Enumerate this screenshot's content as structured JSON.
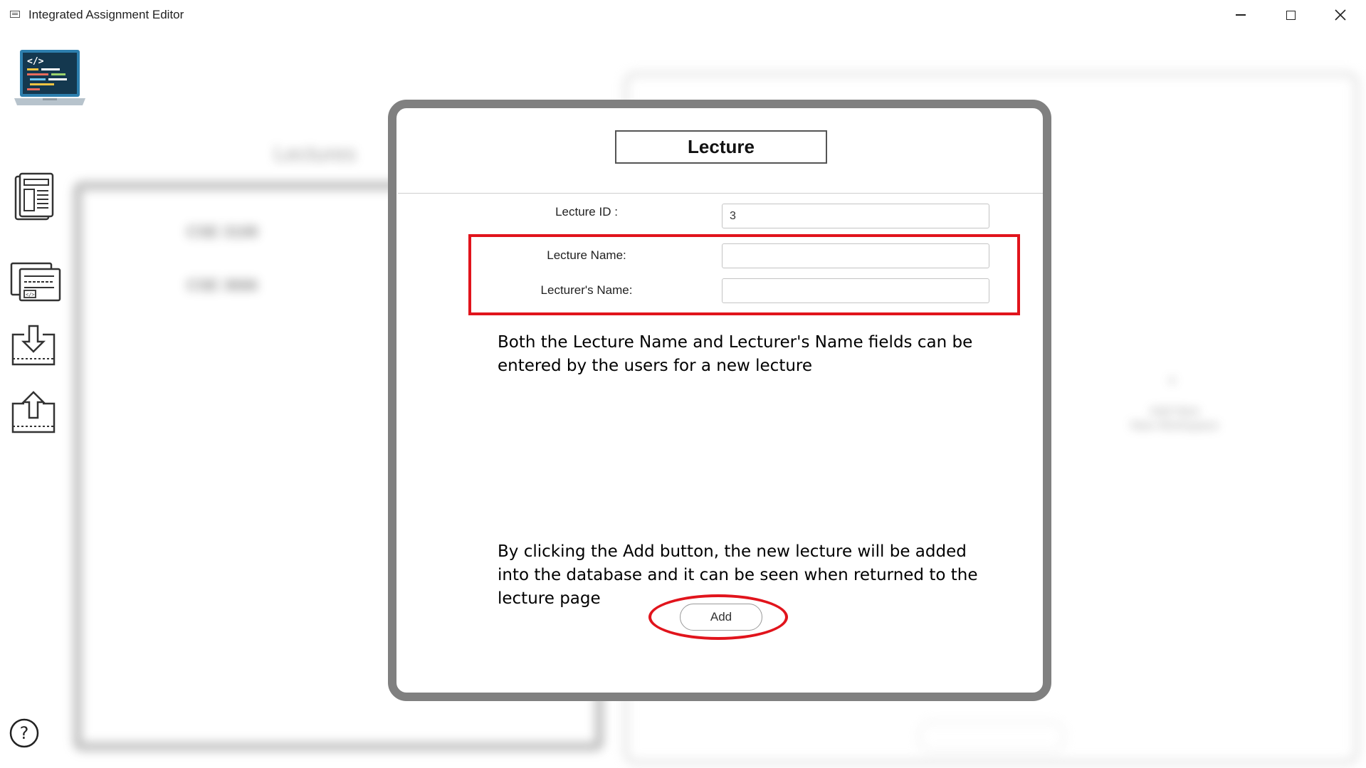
{
  "window": {
    "title": "Integrated Assignment Editor"
  },
  "background": {
    "list_title": "Lectures",
    "rows": [
      "CSE 3108",
      "CSE 3666"
    ],
    "right_panel_text": [
      "Add New",
      "New Workspace"
    ]
  },
  "dialog": {
    "title": "Lecture",
    "fields": {
      "lecture_id_label": "Lecture ID :",
      "lecture_id_value": "3",
      "lecture_name_label": "Lecture Name:",
      "lecture_name_value": "",
      "lecturer_name_label": "Lecturer's Name:",
      "lecturer_name_value": ""
    },
    "add_button": "Add"
  },
  "annotations": {
    "fields_note": "Both the Lecture Name and Lecturer's Name fields can be entered by the users for a new lecture",
    "add_note": "By clicking the Add button, the new lecture will be added into the database and it can be seen when returned to the lecture page"
  },
  "colors": {
    "highlight": "#e1141c",
    "dialog_border": "#808080"
  },
  "icons": [
    "code-laptop-icon",
    "document-icon",
    "code-list-icon",
    "download-icon",
    "upload-icon",
    "help-icon"
  ]
}
